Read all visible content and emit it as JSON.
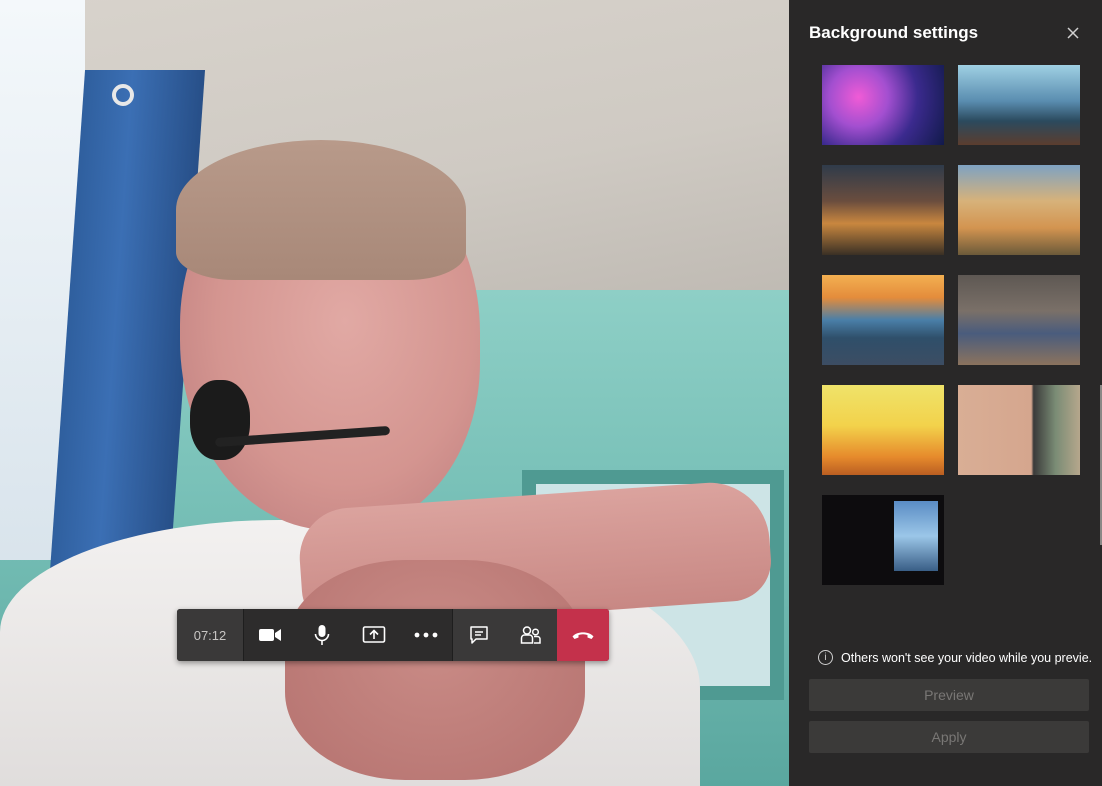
{
  "call_toolbar": {
    "timer": "07:12",
    "buttons": [
      {
        "icon": "video-camera-icon"
      },
      {
        "icon": "microphone-icon"
      },
      {
        "icon": "share-screen-icon"
      },
      {
        "icon": "more-options-icon"
      },
      {
        "icon": "chat-icon"
      },
      {
        "icon": "participants-icon"
      },
      {
        "icon": "hang-up-icon",
        "color": "#c4314b"
      }
    ]
  },
  "panel": {
    "title": "Background settings",
    "close_icon": "close-icon",
    "thumbnails": [
      {
        "name": "nebula-space"
      },
      {
        "name": "coastal-landscape"
      },
      {
        "name": "village-street"
      },
      {
        "name": "golden-hillside"
      },
      {
        "name": "sunset-balcony"
      },
      {
        "name": "sitcom-living-room"
      },
      {
        "name": "this-is-fine-fire"
      },
      {
        "name": "tan-wall-doorway"
      },
      {
        "name": "dark-room-easel"
      }
    ],
    "info_text": "Others won't see your video while you previe...",
    "preview_label": "Preview",
    "apply_label": "Apply"
  },
  "colors": {
    "panel_bg": "#292828",
    "hangup": "#c4314b",
    "toolbar_bg": "#2d2c2c",
    "disabled_text": "#797775"
  }
}
